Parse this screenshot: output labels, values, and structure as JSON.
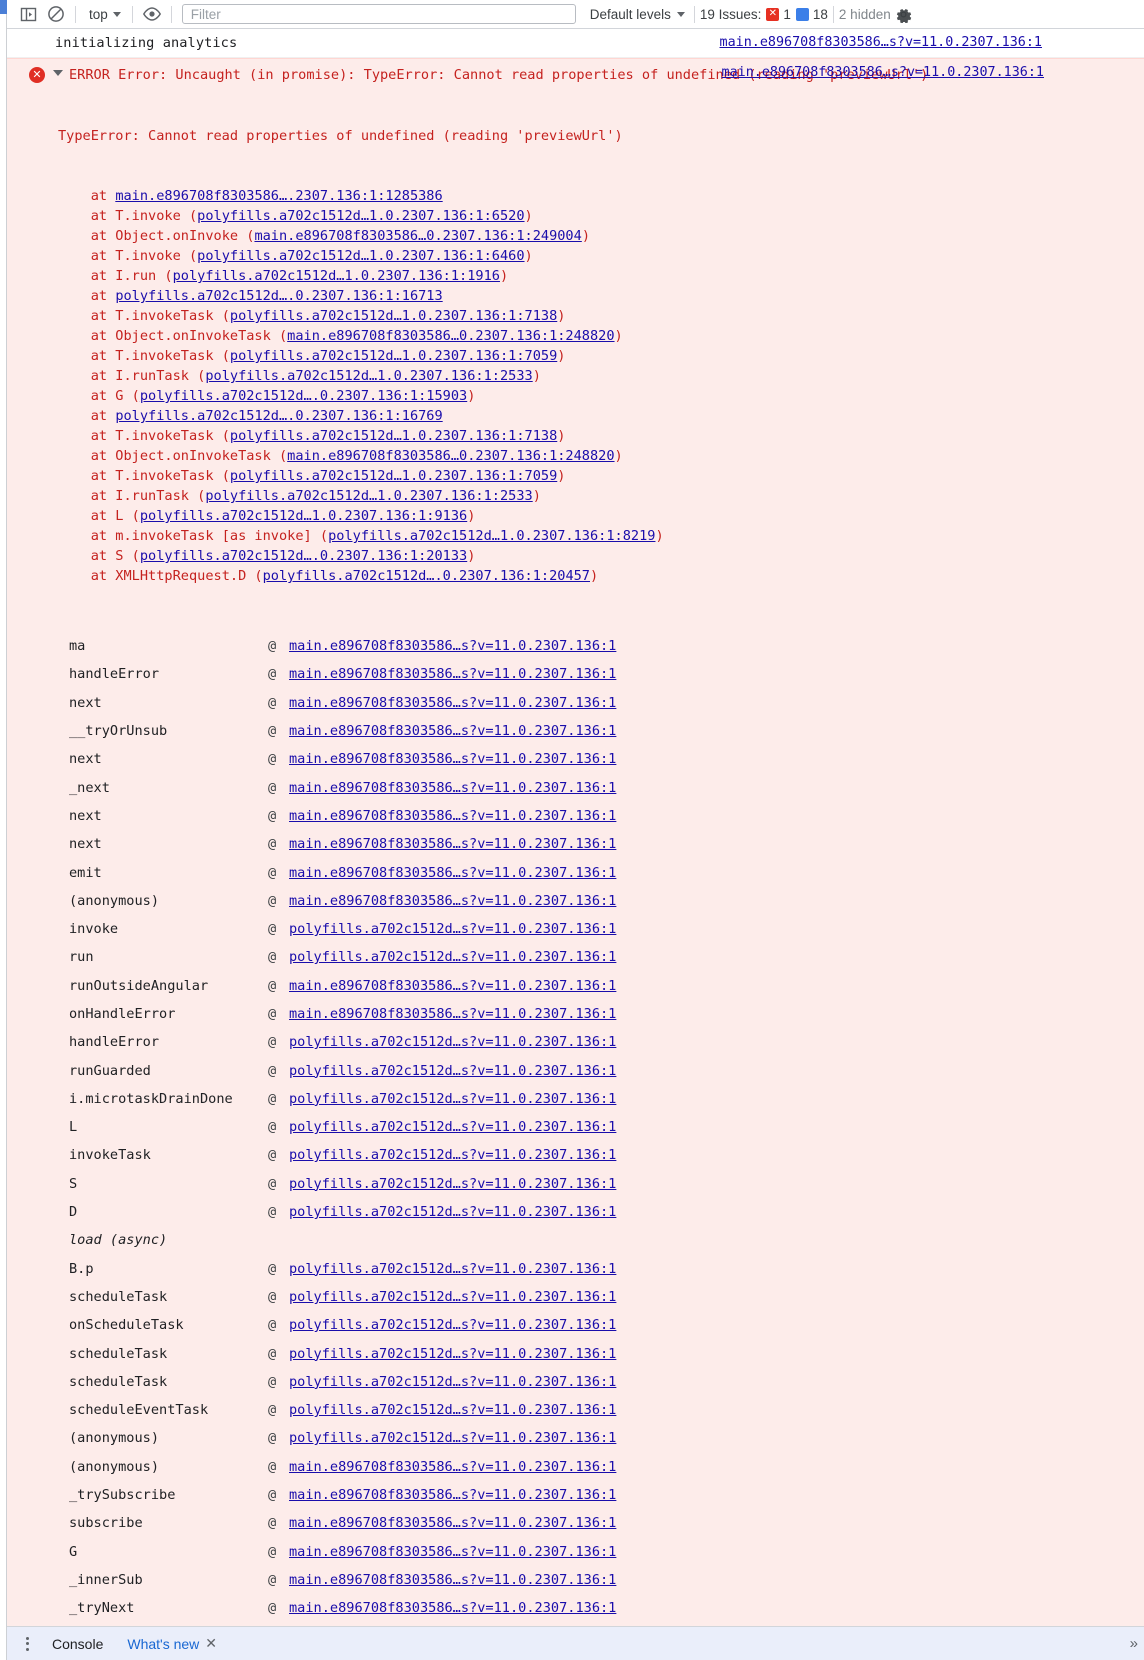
{
  "toolbar": {
    "sidebar_toggle_title": "Show console sidebar",
    "clear_title": "Clear console",
    "context_label": "top",
    "eye_title": "Create live expression",
    "filter_placeholder": "Filter",
    "filter_value": "",
    "levels_label": "Default levels",
    "issues_label": "19 Issues:",
    "issues_error_count": "1",
    "issues_info_count": "18",
    "hidden_label": "2 hidden",
    "settings_title": "Console settings"
  },
  "messages": [
    {
      "kind": "log",
      "text": "initializing analytics",
      "source": "main.e896708f8303586…s?v=11.0.2307.136:1"
    },
    {
      "kind": "error",
      "badge": "✕",
      "header": "ERROR Error: Uncaught (in promise): TypeError: Cannot read properties of undefined (reading 'previewUrl')",
      "header_source": "main.e896708f8303586…s?v=11.0.2307.136:1",
      "stack_text": "TypeError: Cannot read properties of undefined (reading 'previewUrl')",
      "stack": [
        {
          "prefix": "    at ",
          "link": "main.e896708f8303586….2307.136:1:1285386",
          "suffix": ""
        },
        {
          "prefix": "    at T.invoke (",
          "link": "polyfills.a702c1512d…1.0.2307.136:1:6520",
          "suffix": ")"
        },
        {
          "prefix": "    at Object.onInvoke (",
          "link": "main.e896708f8303586…0.2307.136:1:249004",
          "suffix": ")"
        },
        {
          "prefix": "    at T.invoke (",
          "link": "polyfills.a702c1512d…1.0.2307.136:1:6460",
          "suffix": ")"
        },
        {
          "prefix": "    at I.run (",
          "link": "polyfills.a702c1512d…1.0.2307.136:1:1916",
          "suffix": ")"
        },
        {
          "prefix": "    at ",
          "link": "polyfills.a702c1512d….0.2307.136:1:16713",
          "suffix": ""
        },
        {
          "prefix": "    at T.invokeTask (",
          "link": "polyfills.a702c1512d…1.0.2307.136:1:7138",
          "suffix": ")"
        },
        {
          "prefix": "    at Object.onInvokeTask (",
          "link": "main.e896708f8303586…0.2307.136:1:248820",
          "suffix": ")"
        },
        {
          "prefix": "    at T.invokeTask (",
          "link": "polyfills.a702c1512d…1.0.2307.136:1:7059",
          "suffix": ")"
        },
        {
          "prefix": "    at I.runTask (",
          "link": "polyfills.a702c1512d…1.0.2307.136:1:2533",
          "suffix": ")"
        },
        {
          "prefix": "    at G (",
          "link": "polyfills.a702c1512d….0.2307.136:1:15903",
          "suffix": ")"
        },
        {
          "prefix": "    at ",
          "link": "polyfills.a702c1512d….0.2307.136:1:16769",
          "suffix": ""
        },
        {
          "prefix": "    at T.invokeTask (",
          "link": "polyfills.a702c1512d…1.0.2307.136:1:7138",
          "suffix": ")"
        },
        {
          "prefix": "    at Object.onInvokeTask (",
          "link": "main.e896708f8303586…0.2307.136:1:248820",
          "suffix": ")"
        },
        {
          "prefix": "    at T.invokeTask (",
          "link": "polyfills.a702c1512d…1.0.2307.136:1:7059",
          "suffix": ")"
        },
        {
          "prefix": "    at I.runTask (",
          "link": "polyfills.a702c1512d…1.0.2307.136:1:2533",
          "suffix": ")"
        },
        {
          "prefix": "    at L (",
          "link": "polyfills.a702c1512d…1.0.2307.136:1:9136",
          "suffix": ")"
        },
        {
          "prefix": "    at m.invokeTask [as invoke] (",
          "link": "polyfills.a702c1512d…1.0.2307.136:1:8219",
          "suffix": ")"
        },
        {
          "prefix": "    at S (",
          "link": "polyfills.a702c1512d….0.2307.136:1:20133",
          "suffix": ")"
        },
        {
          "prefix": "    at XMLHttpRequest.D (",
          "link": "polyfills.a702c1512d….0.2307.136:1:20457",
          "suffix": ")"
        }
      ],
      "at_symbol": "@",
      "frames": [
        {
          "fn": "ma",
          "url": "main.e896708f8303586…s?v=11.0.2307.136:1"
        },
        {
          "fn": "handleError",
          "url": "main.e896708f8303586…s?v=11.0.2307.136:1"
        },
        {
          "fn": "next",
          "url": "main.e896708f8303586…s?v=11.0.2307.136:1"
        },
        {
          "fn": "__tryOrUnsub",
          "url": "main.e896708f8303586…s?v=11.0.2307.136:1"
        },
        {
          "fn": "next",
          "url": "main.e896708f8303586…s?v=11.0.2307.136:1"
        },
        {
          "fn": "_next",
          "url": "main.e896708f8303586…s?v=11.0.2307.136:1"
        },
        {
          "fn": "next",
          "url": "main.e896708f8303586…s?v=11.0.2307.136:1"
        },
        {
          "fn": "next",
          "url": "main.e896708f8303586…s?v=11.0.2307.136:1"
        },
        {
          "fn": "emit",
          "url": "main.e896708f8303586…s?v=11.0.2307.136:1"
        },
        {
          "fn": "(anonymous)",
          "url": "main.e896708f8303586…s?v=11.0.2307.136:1"
        },
        {
          "fn": "invoke",
          "url": "polyfills.a702c1512d…s?v=11.0.2307.136:1"
        },
        {
          "fn": "run",
          "url": "polyfills.a702c1512d…s?v=11.0.2307.136:1"
        },
        {
          "fn": "runOutsideAngular",
          "url": "main.e896708f8303586…s?v=11.0.2307.136:1"
        },
        {
          "fn": "onHandleError",
          "url": "main.e896708f8303586…s?v=11.0.2307.136:1"
        },
        {
          "fn": "handleError",
          "url": "polyfills.a702c1512d…s?v=11.0.2307.136:1"
        },
        {
          "fn": "runGuarded",
          "url": "polyfills.a702c1512d…s?v=11.0.2307.136:1"
        },
        {
          "fn": "i.microtaskDrainDone",
          "url": "polyfills.a702c1512d…s?v=11.0.2307.136:1"
        },
        {
          "fn": "L",
          "url": "polyfills.a702c1512d…s?v=11.0.2307.136:1"
        },
        {
          "fn": "invokeTask",
          "url": "polyfills.a702c1512d…s?v=11.0.2307.136:1"
        },
        {
          "fn": "S",
          "url": "polyfills.a702c1512d…s?v=11.0.2307.136:1"
        },
        {
          "fn": "D",
          "url": "polyfills.a702c1512d…s?v=11.0.2307.136:1"
        },
        {
          "fn": "load (async)",
          "url": "",
          "async": true
        },
        {
          "fn": "B.p",
          "url": "polyfills.a702c1512d…s?v=11.0.2307.136:1"
        },
        {
          "fn": "scheduleTask",
          "url": "polyfills.a702c1512d…s?v=11.0.2307.136:1"
        },
        {
          "fn": "onScheduleTask",
          "url": "polyfills.a702c1512d…s?v=11.0.2307.136:1"
        },
        {
          "fn": "scheduleTask",
          "url": "polyfills.a702c1512d…s?v=11.0.2307.136:1"
        },
        {
          "fn": "scheduleTask",
          "url": "polyfills.a702c1512d…s?v=11.0.2307.136:1"
        },
        {
          "fn": "scheduleEventTask",
          "url": "polyfills.a702c1512d…s?v=11.0.2307.136:1"
        },
        {
          "fn": "(anonymous)",
          "url": "polyfills.a702c1512d…s?v=11.0.2307.136:1"
        },
        {
          "fn": "(anonymous)",
          "url": "main.e896708f8303586…s?v=11.0.2307.136:1"
        },
        {
          "fn": "_trySubscribe",
          "url": "main.e896708f8303586…s?v=11.0.2307.136:1"
        },
        {
          "fn": "subscribe",
          "url": "main.e896708f8303586…s?v=11.0.2307.136:1"
        },
        {
          "fn": "G",
          "url": "main.e896708f8303586…s?v=11.0.2307.136:1"
        },
        {
          "fn": "_innerSub",
          "url": "main.e896708f8303586…s?v=11.0.2307.136:1"
        },
        {
          "fn": "_tryNext",
          "url": "main.e896708f8303586…s?v=11.0.2307.136:1"
        }
      ]
    }
  ],
  "drawer": {
    "menu_title": "More tools",
    "tabs": [
      {
        "label": "Console",
        "active": true,
        "link": false,
        "closable": false
      },
      {
        "label": "What's new",
        "active": false,
        "link": true,
        "closable": true
      }
    ],
    "close_glyph": "✕",
    "more_glyph": "»"
  },
  "colors": {
    "error_bg": "#fdecea",
    "error_text": "#c5221f",
    "link": "#1a0dab",
    "drawer_bg": "#eaeefa",
    "accent_blue": "#3b7fe8",
    "error_red": "#e63022"
  }
}
